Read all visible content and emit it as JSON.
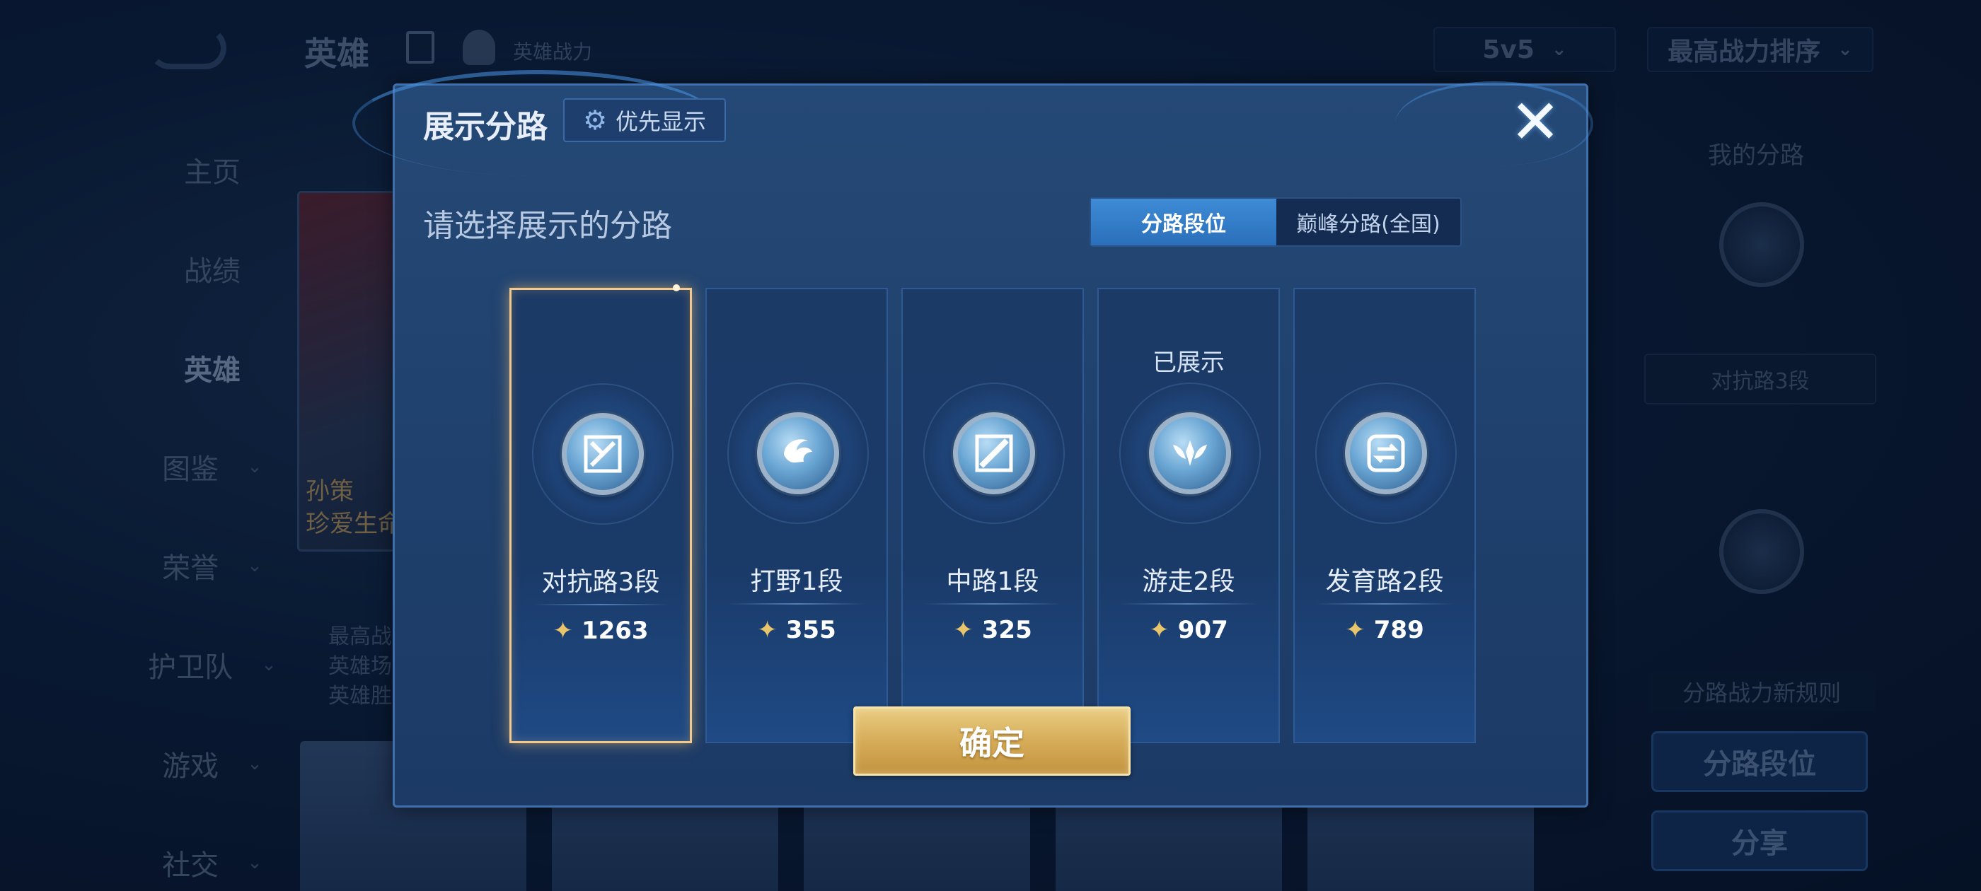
{
  "background": {
    "top_title": "英雄",
    "top_power_label": "英雄战力",
    "mode_select": "5v5",
    "sort_select": "最高战力排序",
    "side_nav": [
      {
        "label": "主页",
        "has_sub": false
      },
      {
        "label": "战绩",
        "has_sub": false
      },
      {
        "label": "英雄",
        "has_sub": false,
        "active": true
      },
      {
        "label": "图鉴",
        "has_sub": true
      },
      {
        "label": "荣誉",
        "has_sub": true
      },
      {
        "label": "护卫队",
        "has_sub": true
      },
      {
        "label": "游戏",
        "has_sub": true
      },
      {
        "label": "社交",
        "has_sub": true
      }
    ],
    "hero_card_name_line1": "孙策",
    "hero_card_name_line2": "珍爱生命",
    "hero_stats": [
      "最高战",
      "英雄场",
      "英雄胜"
    ],
    "right_panel": {
      "title": "我的分路",
      "lane_label": "对抗路3段",
      "rule_label": "分路战力新规则",
      "lane_rank_button": "分路段位",
      "share_button": "分享"
    }
  },
  "dialog": {
    "title": "展示分路",
    "priority_button": "优先显示",
    "close_icon": "close-icon",
    "subtitle": "请选择展示的分路",
    "tabs": [
      {
        "label": "分路段位",
        "active": true
      },
      {
        "label": "巅峰分路(全国)",
        "active": false
      }
    ],
    "lanes": [
      {
        "name": "对抗路3段",
        "power": "1263",
        "selected": true,
        "shown_tag": "",
        "icon": "clash-lane-icon"
      },
      {
        "name": "打野1段",
        "power": "355",
        "selected": false,
        "shown_tag": "",
        "icon": "jungle-icon"
      },
      {
        "name": "中路1段",
        "power": "325",
        "selected": false,
        "shown_tag": "",
        "icon": "mid-lane-icon"
      },
      {
        "name": "游走2段",
        "power": "907",
        "selected": false,
        "shown_tag": "已展示",
        "icon": "roam-icon"
      },
      {
        "name": "发育路2段",
        "power": "789",
        "selected": false,
        "shown_tag": "",
        "icon": "farm-lane-icon"
      }
    ],
    "confirm_button": "确定"
  },
  "colors": {
    "accent_blue": "#3e8bd6",
    "selected_border": "#f2c98a",
    "confirm_gold": "#d6ac58",
    "power_icon": "#e8c46a"
  }
}
